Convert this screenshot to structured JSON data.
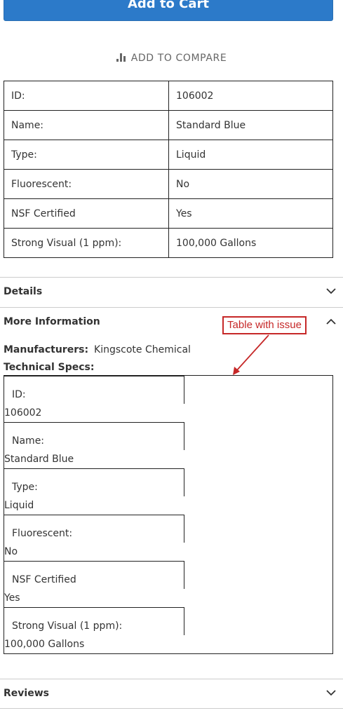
{
  "cart": {
    "label": "Add to Cart"
  },
  "compare": {
    "label": "ADD TO COMPARE",
    "icon": "bar-chart-icon"
  },
  "specs": [
    {
      "key": "ID:",
      "value": "106002"
    },
    {
      "key": "Name:",
      "value": "Standard Blue"
    },
    {
      "key": "Type:",
      "value": "Liquid"
    },
    {
      "key": "Fluorescent:",
      "value": "No"
    },
    {
      "key": "NSF Certified",
      "value": "Yes"
    },
    {
      "key": "Strong Visual (1 ppm):",
      "value": "100,000 Gallons"
    }
  ],
  "sections": {
    "details": "Details",
    "more_info": "More Information",
    "reviews": "Reviews"
  },
  "annotation": "Table with issue",
  "more_info": {
    "manufacturers_label": "Manufacturers:",
    "manufacturers_value": "Kingscote Chemical",
    "tech_specs_label": "Technical Specs:"
  },
  "colors": {
    "button": "#2c7ac9",
    "annotation": "#c62828"
  }
}
